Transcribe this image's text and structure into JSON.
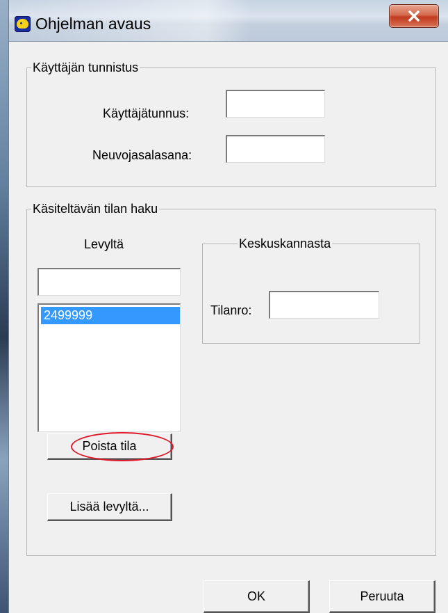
{
  "window": {
    "title": "Ohjelman avaus",
    "close_glyph": "X",
    "app_icon": "app-icon"
  },
  "user_identification": {
    "legend": "Käyttäjän tunnistus",
    "username_label": "Käyttäjätunnus:",
    "username_value": "",
    "password_label": "Neuvojasalasana:",
    "password_value": ""
  },
  "farm_search": {
    "legend": "Käsiteltävän tilan haku",
    "disk": {
      "label": "Levyltä",
      "search_value": "",
      "list_items": [
        "2499999"
      ],
      "selected_index": 0,
      "remove_button": "Poista tila",
      "add_button": "Lisää levyltä..."
    },
    "central_db": {
      "legend": "Keskuskannasta",
      "farm_no_label": "Tilanro:",
      "farm_no_value": ""
    }
  },
  "footer": {
    "ok_button": "OK",
    "cancel_button": "Peruuta"
  },
  "colors": {
    "selection": "#3399ff",
    "annotation": "#e0192a",
    "close_button": "#c0391d"
  }
}
